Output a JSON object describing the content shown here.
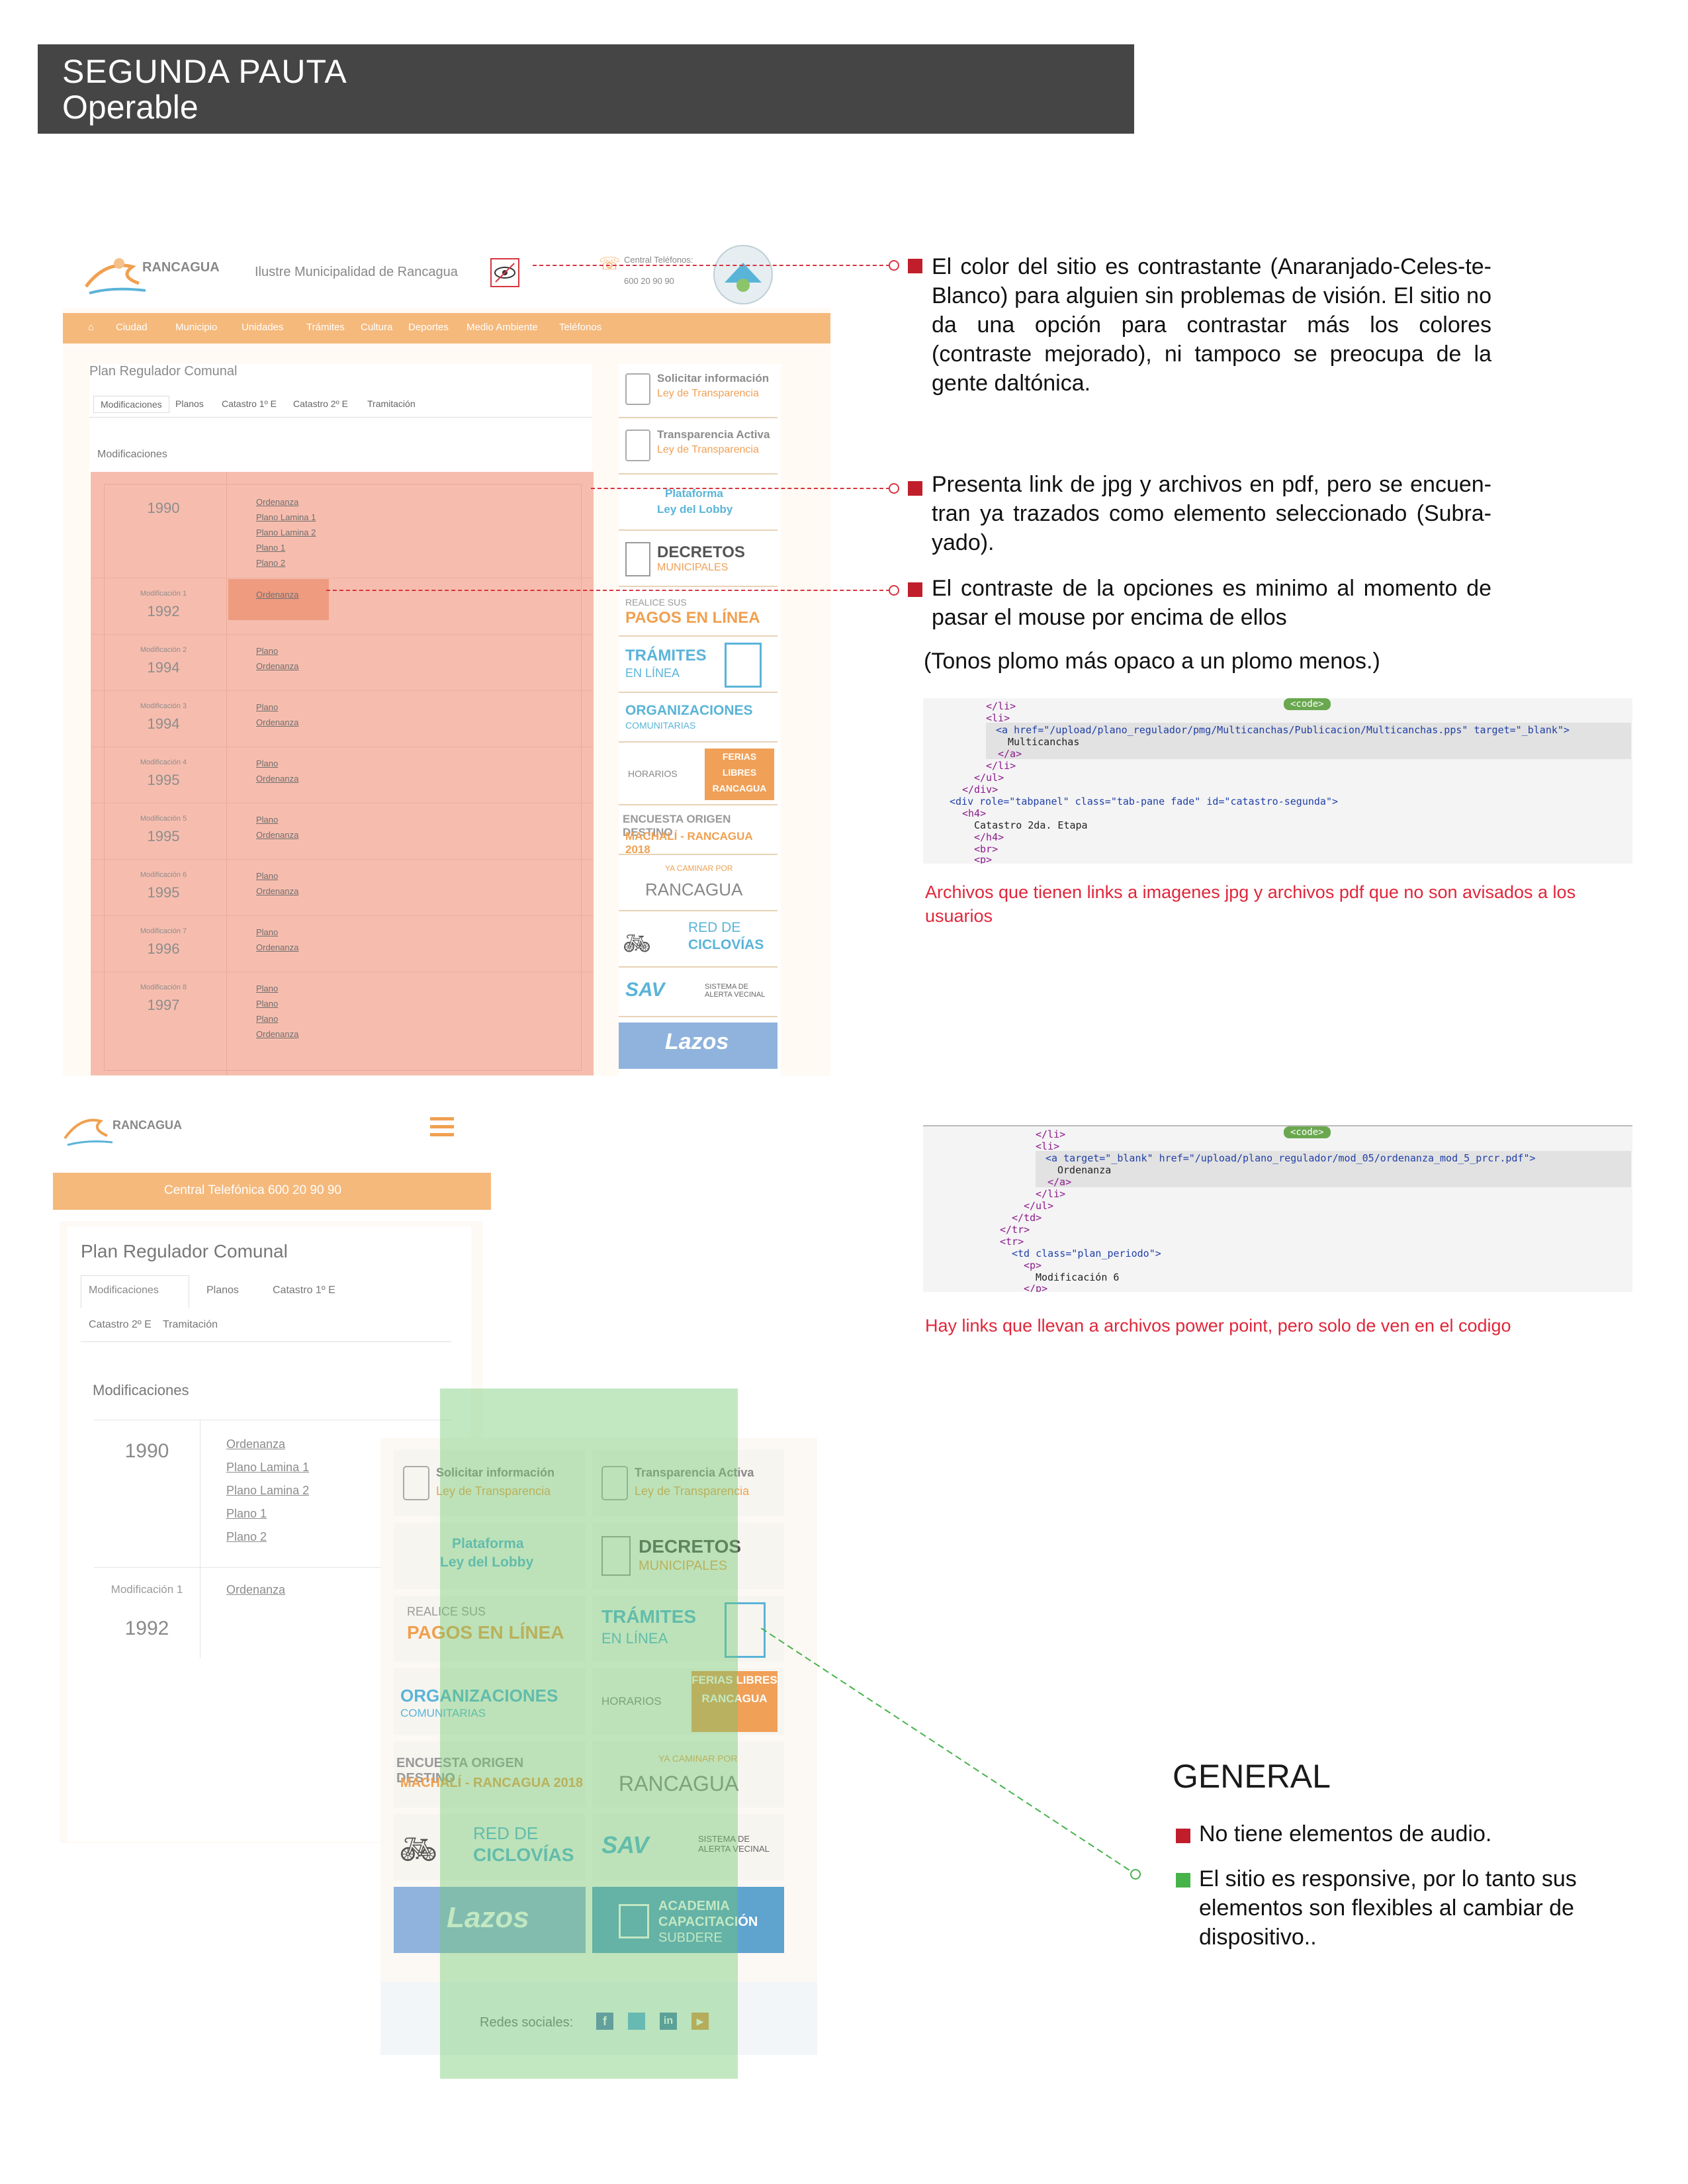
{
  "header": {
    "title": "SEGUNDA PAUTA",
    "subtitle": "Operable"
  },
  "notes": {
    "n1": "El color del sitio es contrastante (Anaranjado-Celes-te-Blanco) para alguien sin problemas de visión. El sitio no da una opción para contrastar más los colores (contraste mejorado), ni tampoco se preocupa de la gente daltónica.",
    "n2": "Presenta link de jpg y archivos en pdf, pero se encuen-tran ya trazados como elemento seleccionado (Subra-yado).",
    "n3": "El contraste de la opciones es minimo al momento de pasar el mouse por encima de ellos",
    "n3b": "(Tonos plomo más opaco a un plomo menos.)",
    "cap1": "Archivos que tienen links a imagenes jpg y archivos pdf que no son avisados a los usuarios",
    "cap2": "Hay links que llevan a archivos power point, pero solo de ven en el codigo"
  },
  "general": {
    "title": "GENERAL",
    "items": [
      {
        "text": "No tiene elementos de audio.",
        "color": "#c01e2b"
      },
      {
        "text": "El sitio es responsive, por lo tanto sus elementos son flexibles al cambiar de dispositivo..",
        "color": "#46b34a"
      }
    ]
  },
  "code1": {
    "pill": "<code>",
    "lines": [
      "</li>",
      "<li>",
      "<a href=\"/upload/plano_regulador/pmg/Multicanchas/Publicacion/Multicanchas.pps\" target=\"_blank\">",
      "Multicanchas",
      "</a>",
      "</li>",
      "</ul>",
      "</div>",
      "<div role=\"tabpanel\" class=\"tab-pane fade\" id=\"catastro-segunda\">",
      "<h4>",
      "Catastro 2da. Etapa",
      "</h4>",
      "<br>",
      "<p>"
    ]
  },
  "code2": {
    "pill": "<code>",
    "lines": [
      "</li>",
      "<li>",
      "<a target=\"_blank\" href=\"/upload/plano_regulador/mod_05/ordenanza_mod_5_prcr.pdf\">",
      "Ordenanza",
      "</a>",
      "</li>",
      "</ul>",
      "</td>",
      "</tr>",
      "<tr>",
      "<td class=\"plan_periodo\">",
      "<p>",
      "Modificación 6",
      "</p>"
    ]
  },
  "site": {
    "logo": "RANCAGUA",
    "muni": "Ilustre Municipalidad de Rancagua",
    "phone_label": "Central Teléfonos:",
    "phone": "600 20 90 90",
    "nav": [
      "Ciudad",
      "Municipio",
      "Unidades",
      "Trámites",
      "Cultura",
      "Deportes",
      "Medio Ambiente",
      "Teléfonos"
    ],
    "page_title": "Plan Regulador Comunal",
    "tabs": [
      "Modificaciones",
      "Planos",
      "Catastro 1º E",
      "Catastro 2º E",
      "Tramitación"
    ],
    "section": "Modificaciones",
    "rows": [
      {
        "mod": "",
        "year": "1990",
        "links": [
          "Ordenanza",
          "Plano Lamina 1",
          "Plano Lamina 2",
          "Plano 1",
          "Plano 2"
        ]
      },
      {
        "mod": "Modificación 1",
        "year": "1992",
        "links": [
          "Ordenanza"
        ]
      },
      {
        "mod": "Modificación 2",
        "year": "1994",
        "links": [
          "Plano",
          "Ordenanza"
        ]
      },
      {
        "mod": "Modificación 3",
        "year": "1994",
        "links": [
          "Plano",
          "Ordenanza"
        ]
      },
      {
        "mod": "Modificación 4",
        "year": "1995",
        "links": [
          "Plano",
          "Ordenanza"
        ]
      },
      {
        "mod": "Modificación 5",
        "year": "1995",
        "links": [
          "Plano",
          "Ordenanza"
        ]
      },
      {
        "mod": "Modificación 6",
        "year": "1995",
        "links": [
          "Plano",
          "Ordenanza"
        ]
      },
      {
        "mod": "Modificación 7",
        "year": "1996",
        "links": [
          "Plano",
          "Ordenanza"
        ]
      },
      {
        "mod": "Modificación 8",
        "year": "1997",
        "links": [
          "Plano",
          "Plano",
          "Plano",
          "Ordenanza"
        ]
      }
    ],
    "side": {
      "solicitar_t": "Solicitar información",
      "solicitar_s": "Ley de Transparencia",
      "transp_t": "Transparencia Activa",
      "transp_s": "Ley de Transparencia",
      "lobby_1": "Plataforma",
      "lobby_2": "Ley del Lobby",
      "decretos_t": "DECRETOS",
      "decretos_s": "MUNICIPALES",
      "pagos_s": "REALICE SUS",
      "pagos_t": "PAGOS EN LÍNEA",
      "tramites_t": "TRÁMITES",
      "tramites_s": "EN LÍNEA",
      "org_t": "ORGANIZACIONES",
      "org_s": "COMUNITARIAS",
      "horarios": "HORARIOS",
      "ferias": "FERIAS LIBRES RANCAGUA",
      "encuesta_1": "ENCUESTA ORIGEN DESTINO",
      "encuesta_2": "MACHALÍ - RANCAGUA 2018",
      "caminar_s": "YA CAMINAR POR",
      "caminar_t": "RANCAGUA",
      "red_1": "RED DE",
      "red_2": "CICLOVÍAS",
      "sav": "SAV",
      "sav_s": "SISTEMA DE ALERTA VECINAL",
      "lazos": "Lazos",
      "academia_1": "ACADEMIA",
      "academia_2": "CAPACITACIÓN",
      "academia_3": "SUBDERE",
      "redes": "Redes sociales:"
    },
    "mobile_phone": "Central Telefónica 600 20 90 90"
  }
}
